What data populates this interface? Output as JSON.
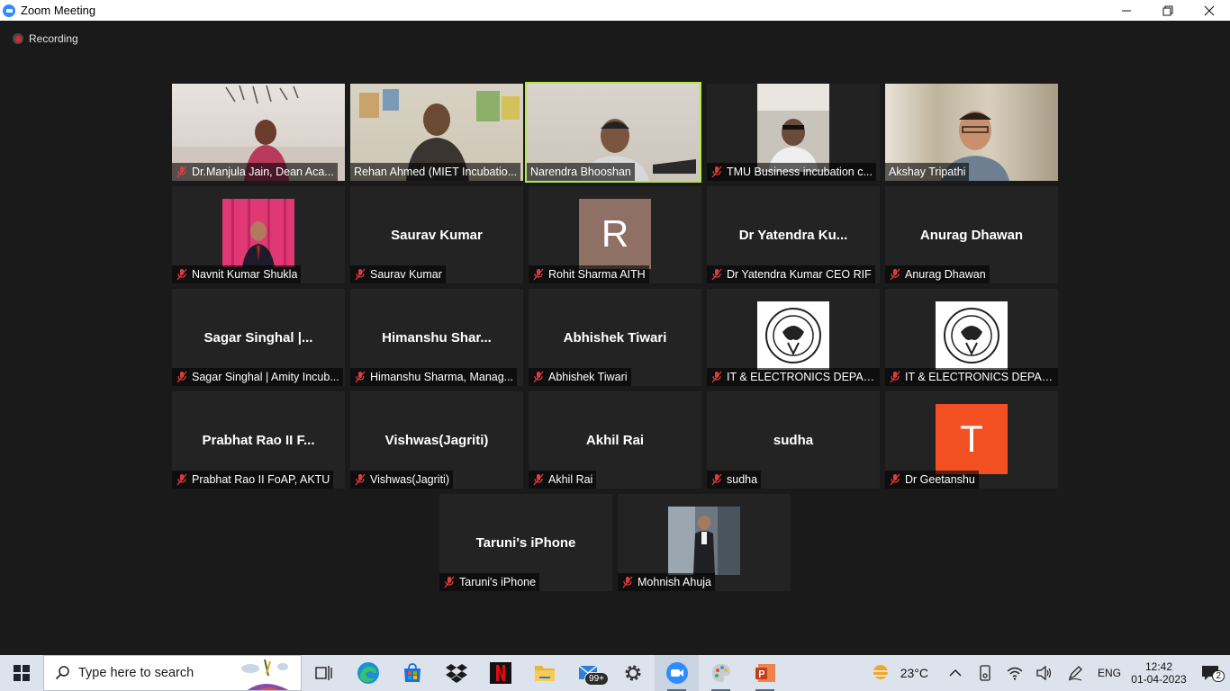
{
  "window": {
    "title": "Zoom Meeting",
    "controls": [
      "—",
      "❐",
      "✕"
    ]
  },
  "meeting": {
    "recording_label": "Recording",
    "tiles": [
      {
        "label": "Dr.Manjula Jain, Dean Aca...",
        "center": ""
      },
      {
        "label": "Rehan Ahmed (MIET Incubatio...",
        "center": ""
      },
      {
        "label": "Narendra Bhooshan",
        "center": ""
      },
      {
        "label": "TMU Business incubation c...",
        "center": ""
      },
      {
        "label": "Akshay Tripathi",
        "center": ""
      },
      {
        "label": "Navnit Kumar Shukla",
        "center": ""
      },
      {
        "label": "Saurav Kumar",
        "center": "Saurav Kumar"
      },
      {
        "label": "Rohit Sharma AITH",
        "center": "R"
      },
      {
        "label": "Dr Yatendra Kumar CEO RIF",
        "center": "Dr Yatendra Ku..."
      },
      {
        "label": "Anurag Dhawan",
        "center": "Anurag Dhawan"
      },
      {
        "label": "Sagar Singhal | Amity Incub...",
        "center": "Sagar  Singhal  |..."
      },
      {
        "label": "Himanshu Sharma, Manag...",
        "center": "Himanshu  Shar..."
      },
      {
        "label": "Abhishek Tiwari",
        "center": "Abhishek Tiwari"
      },
      {
        "label": "IT & ELECTRONICS DEPART...",
        "center": ""
      },
      {
        "label": "IT & ELECTRONICS DEPART...",
        "center": ""
      },
      {
        "label": "Prabhat Rao II FoAP, AKTU",
        "center": "Prabhat Rao II F..."
      },
      {
        "label": "Vishwas(Jagriti)",
        "center": "Vishwas(Jagriti)"
      },
      {
        "label": "Akhil Rai",
        "center": "Akhil Rai"
      },
      {
        "label": "sudha",
        "center": "sudha"
      },
      {
        "label": "Dr Geetanshu",
        "center": "T"
      },
      {
        "label": "Taruni's iPhone",
        "center": "Taruni's iPhone"
      },
      {
        "label": "Mohnish Ahuja",
        "center": ""
      }
    ]
  },
  "taskbar": {
    "search_placeholder": "Type here to search",
    "mail_badge": "99+",
    "weather": "23°C",
    "language": "ENG",
    "time": "12:42",
    "date": "01-04-2023",
    "notifications": "2"
  },
  "colors": {
    "active_speaker_border": "#b8e64a",
    "rohit_avatar": "#8e7164",
    "geetanshu_avatar": "#f25022",
    "meeting_bg": "#1a1a1a",
    "tile_bg": "#232323"
  }
}
